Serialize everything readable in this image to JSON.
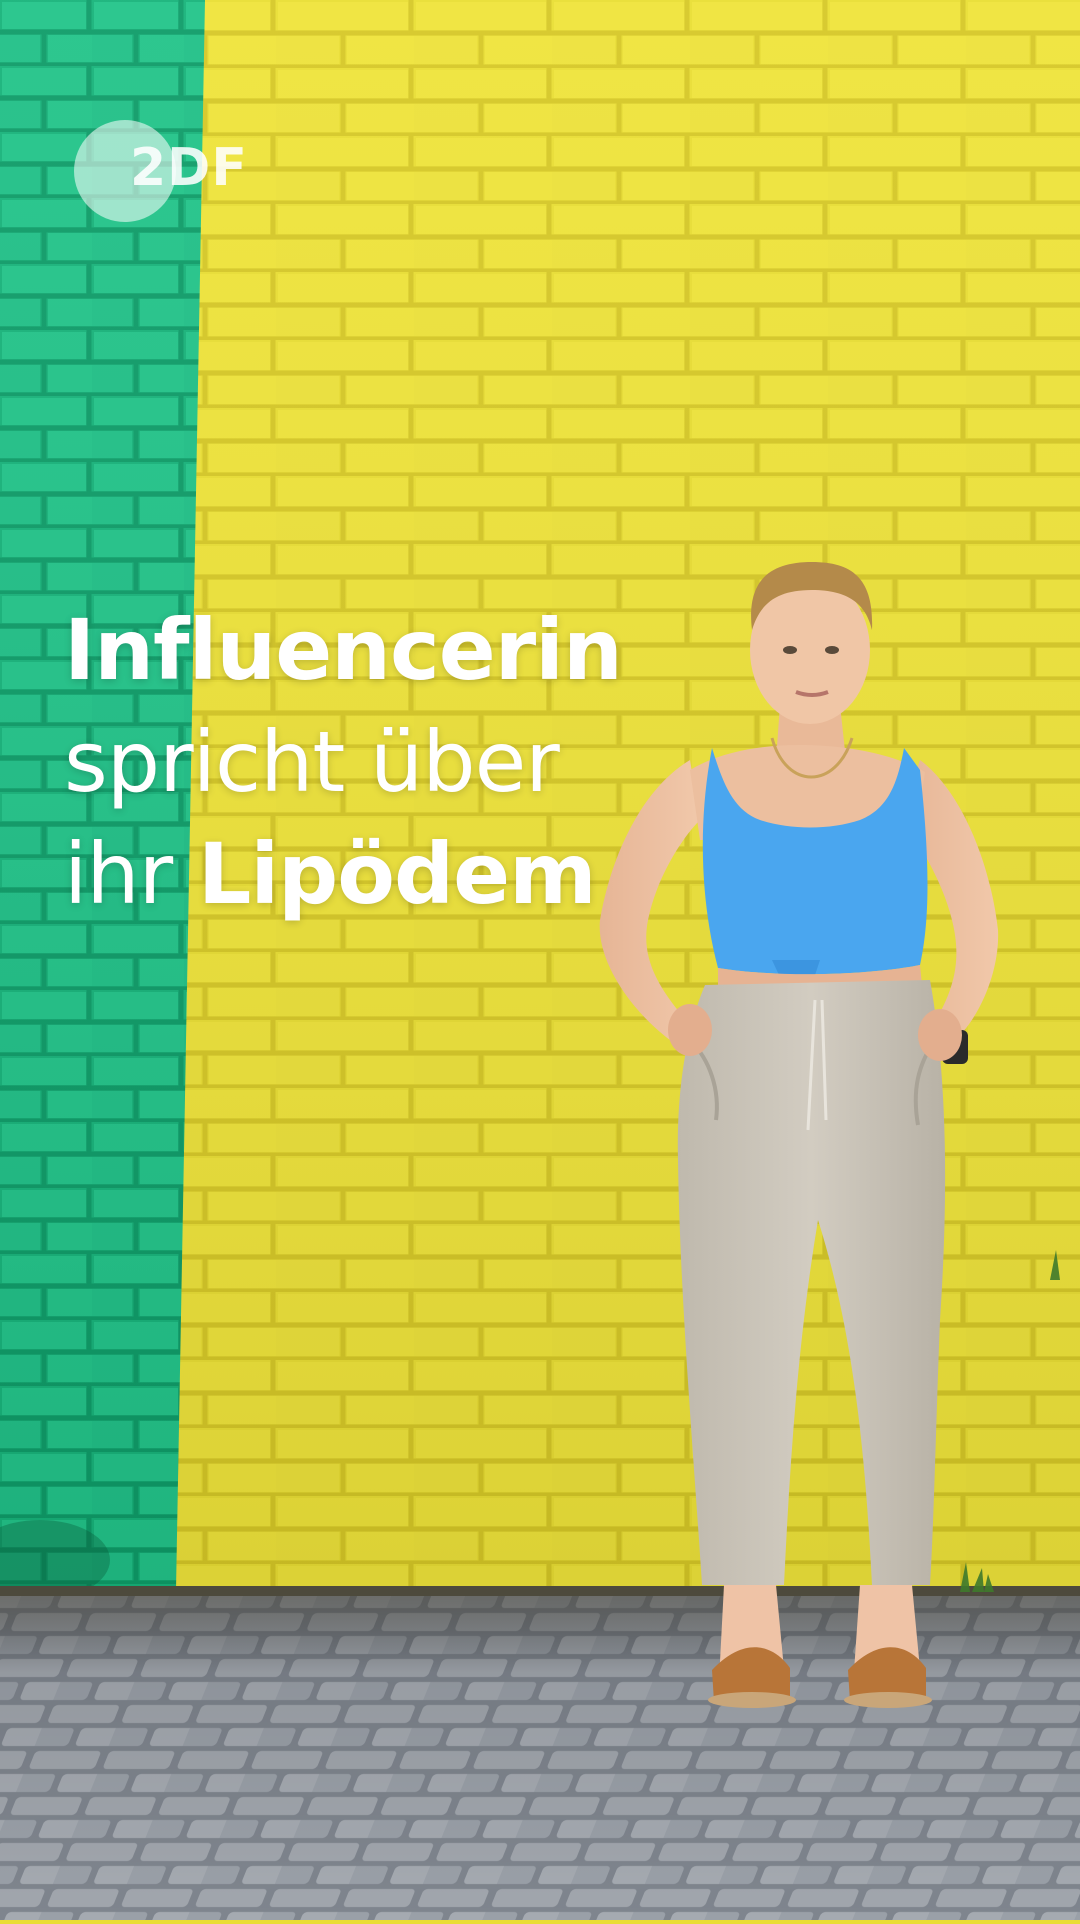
{
  "logo": {
    "text": "2DF",
    "icon": "zdf-logo-icon"
  },
  "caption": {
    "line1_bold": "Influencerin",
    "line2": "spricht über",
    "line3_prefix": "ihr ",
    "line3_bold": "Lipödem"
  },
  "colors": {
    "wall_yellow": "#eadf32",
    "wall_green": "#1fbf83",
    "top_blue": "#4aa7ef",
    "trousers_beige": "#c9c3b7",
    "pavement": "#8d929a"
  }
}
